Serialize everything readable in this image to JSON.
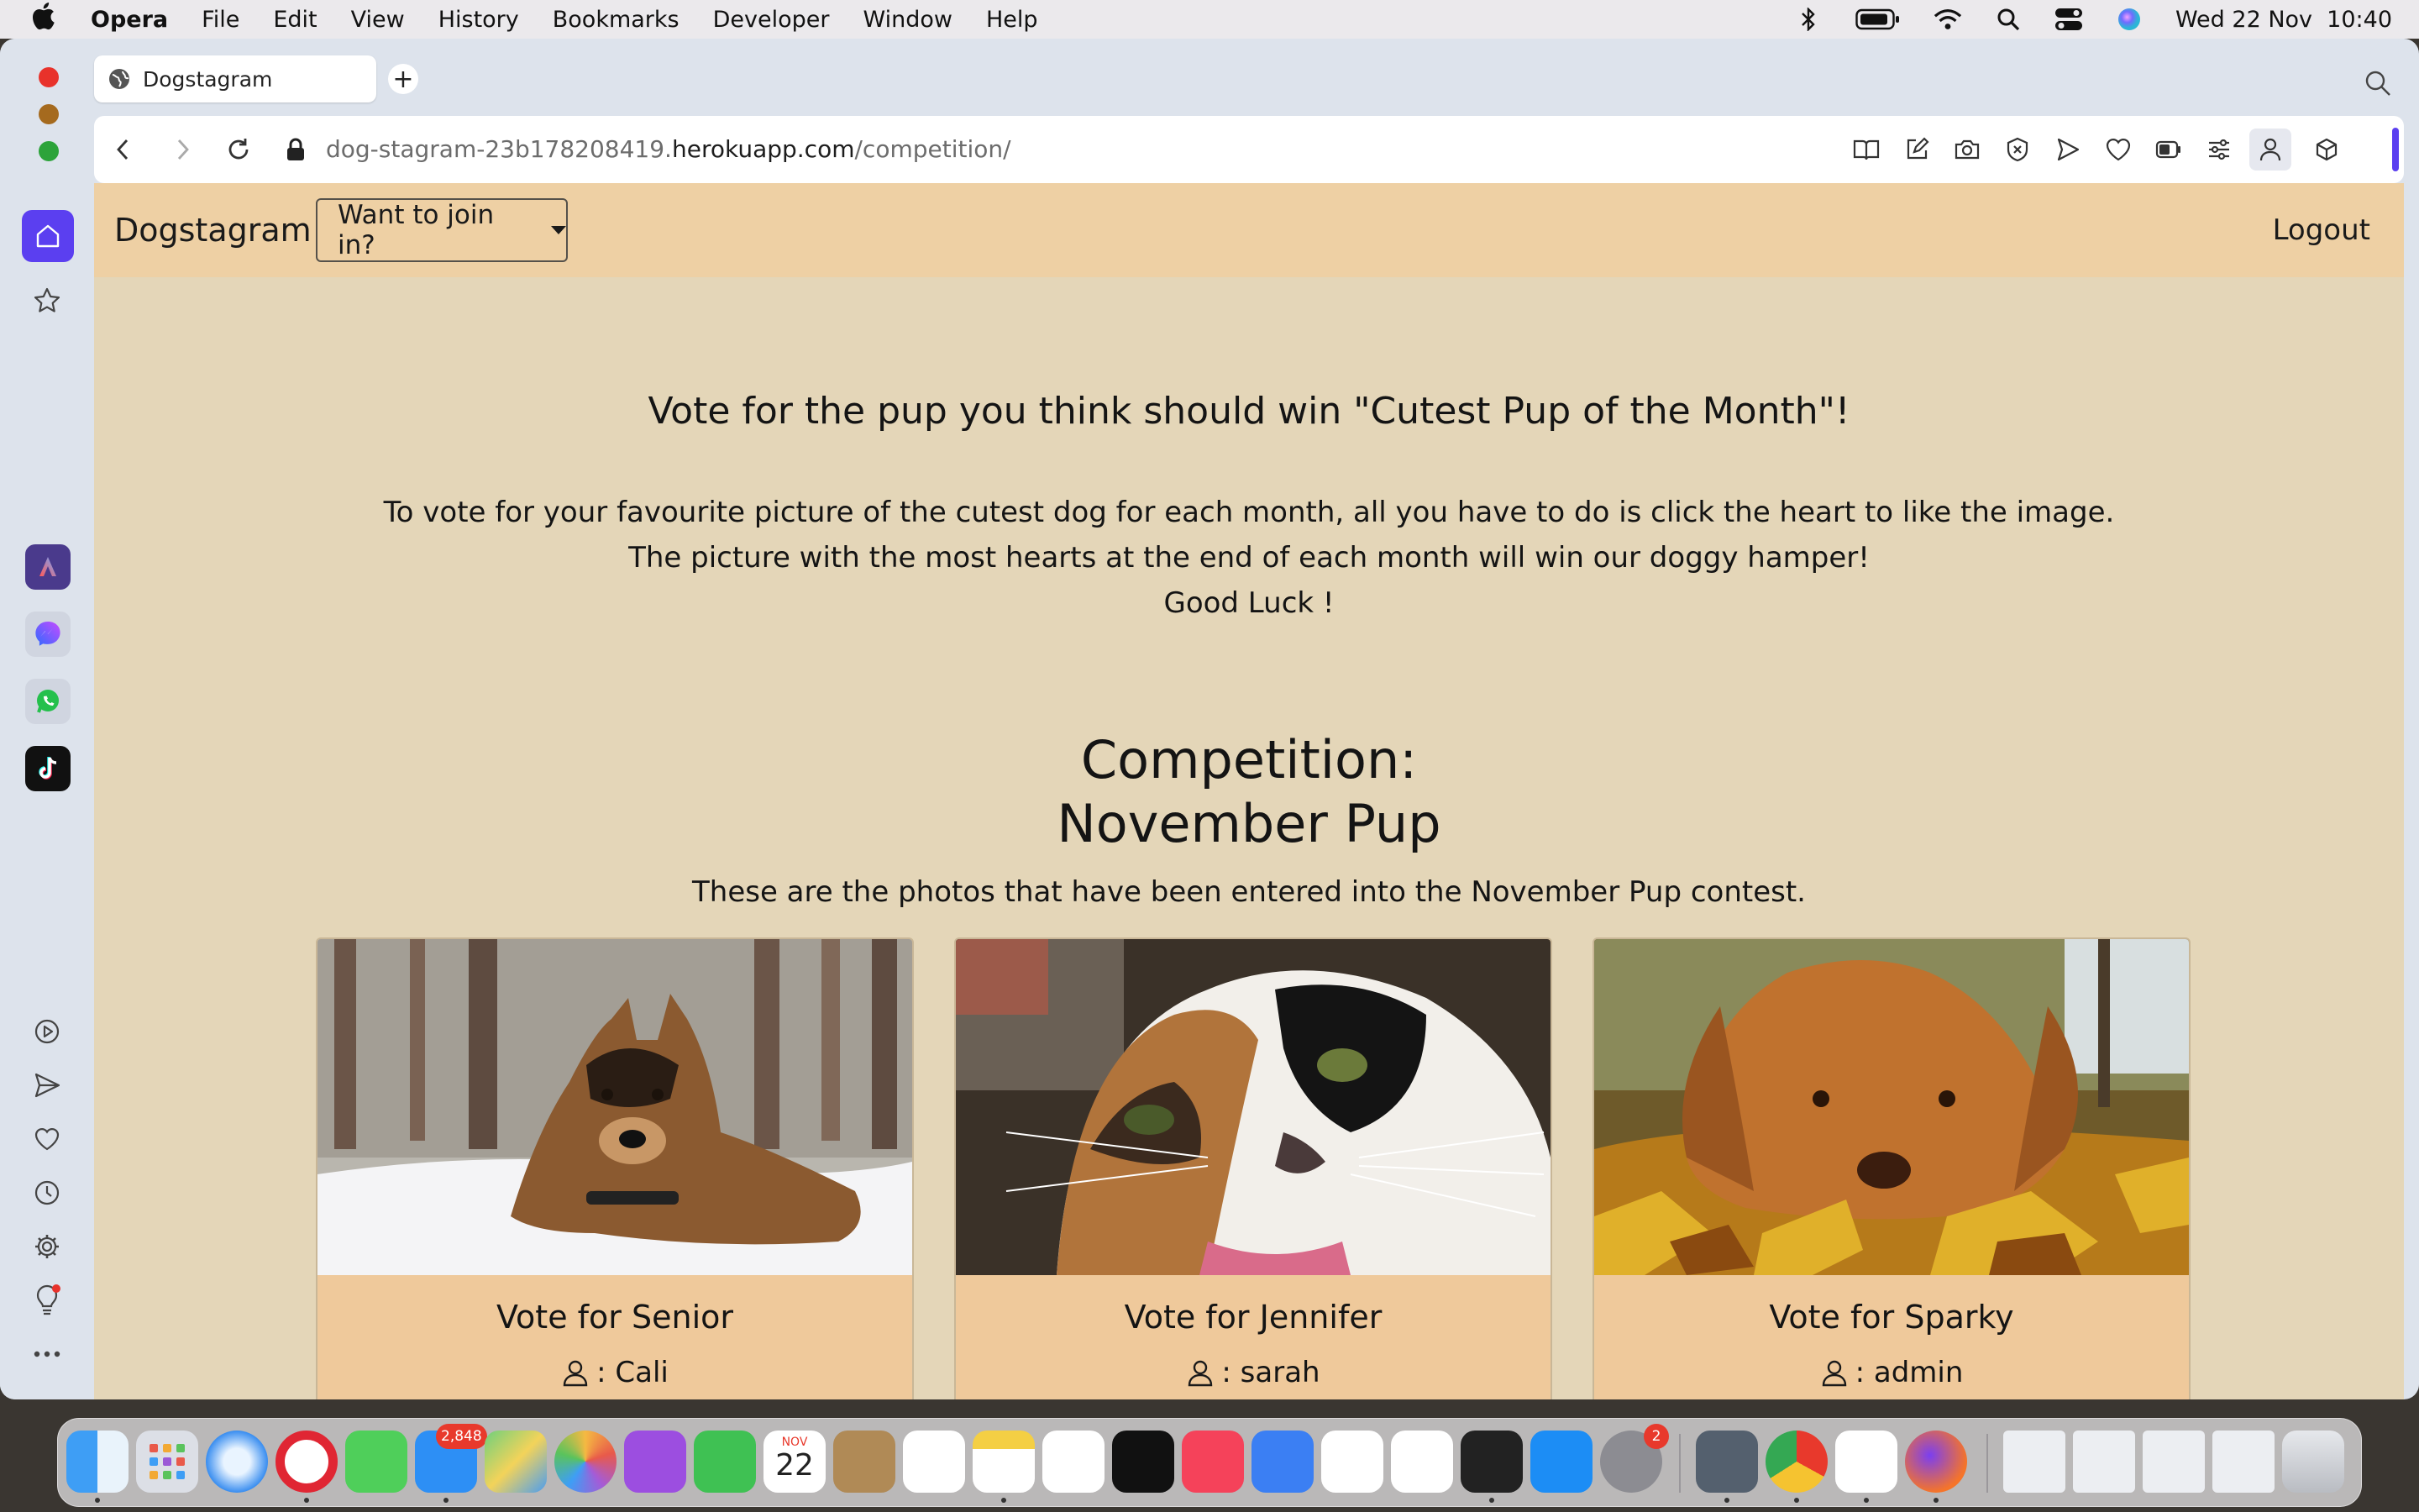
{
  "menubar": {
    "app": "Opera",
    "items": [
      "File",
      "Edit",
      "View",
      "History",
      "Bookmarks",
      "Developer",
      "Window",
      "Help"
    ],
    "clock": "Wed 22 Nov  10:40"
  },
  "browser": {
    "tab_title": "Dogstagram",
    "url_prefix": "dog-stagram-23b178208419.",
    "url_host": "herokuapp.com",
    "url_path": "/competition/"
  },
  "site": {
    "brand": "Dogstagram",
    "join_label": "Want to join in?",
    "logout_label": "Logout",
    "headline": "Vote for the pup you think should win \"Cutest Pup of the Month\"!",
    "intro_line1": "To vote for your favourite picture of the cutest dog for each month, all you have to do is click the heart to like the image.",
    "intro_line2": "The picture with the most hearts at the end of each month will win our doggy hamper!",
    "intro_line3": "Good Luck !",
    "competition_line1": "Competition:",
    "competition_line2": "November Pup",
    "competition_desc": "These are the photos that have been entered into the November Pup contest.",
    "entries": [
      {
        "vote_label": "Vote for Senior",
        "owner": ": Cali"
      },
      {
        "vote_label": "Vote for Jennifer",
        "owner": ": sarah"
      },
      {
        "vote_label": "Vote for Sparky",
        "owner": ": admin"
      }
    ]
  },
  "dock": {
    "mail_badge": "2,848",
    "calendar_month": "NOV",
    "calendar_day": "22",
    "settings_badge": "2"
  },
  "colors": {
    "page_bg": "#e4d6b8",
    "navbar_bg": "#eed0a4",
    "card_bg": "#efc99b",
    "opera_accent": "#5b3ff0"
  }
}
